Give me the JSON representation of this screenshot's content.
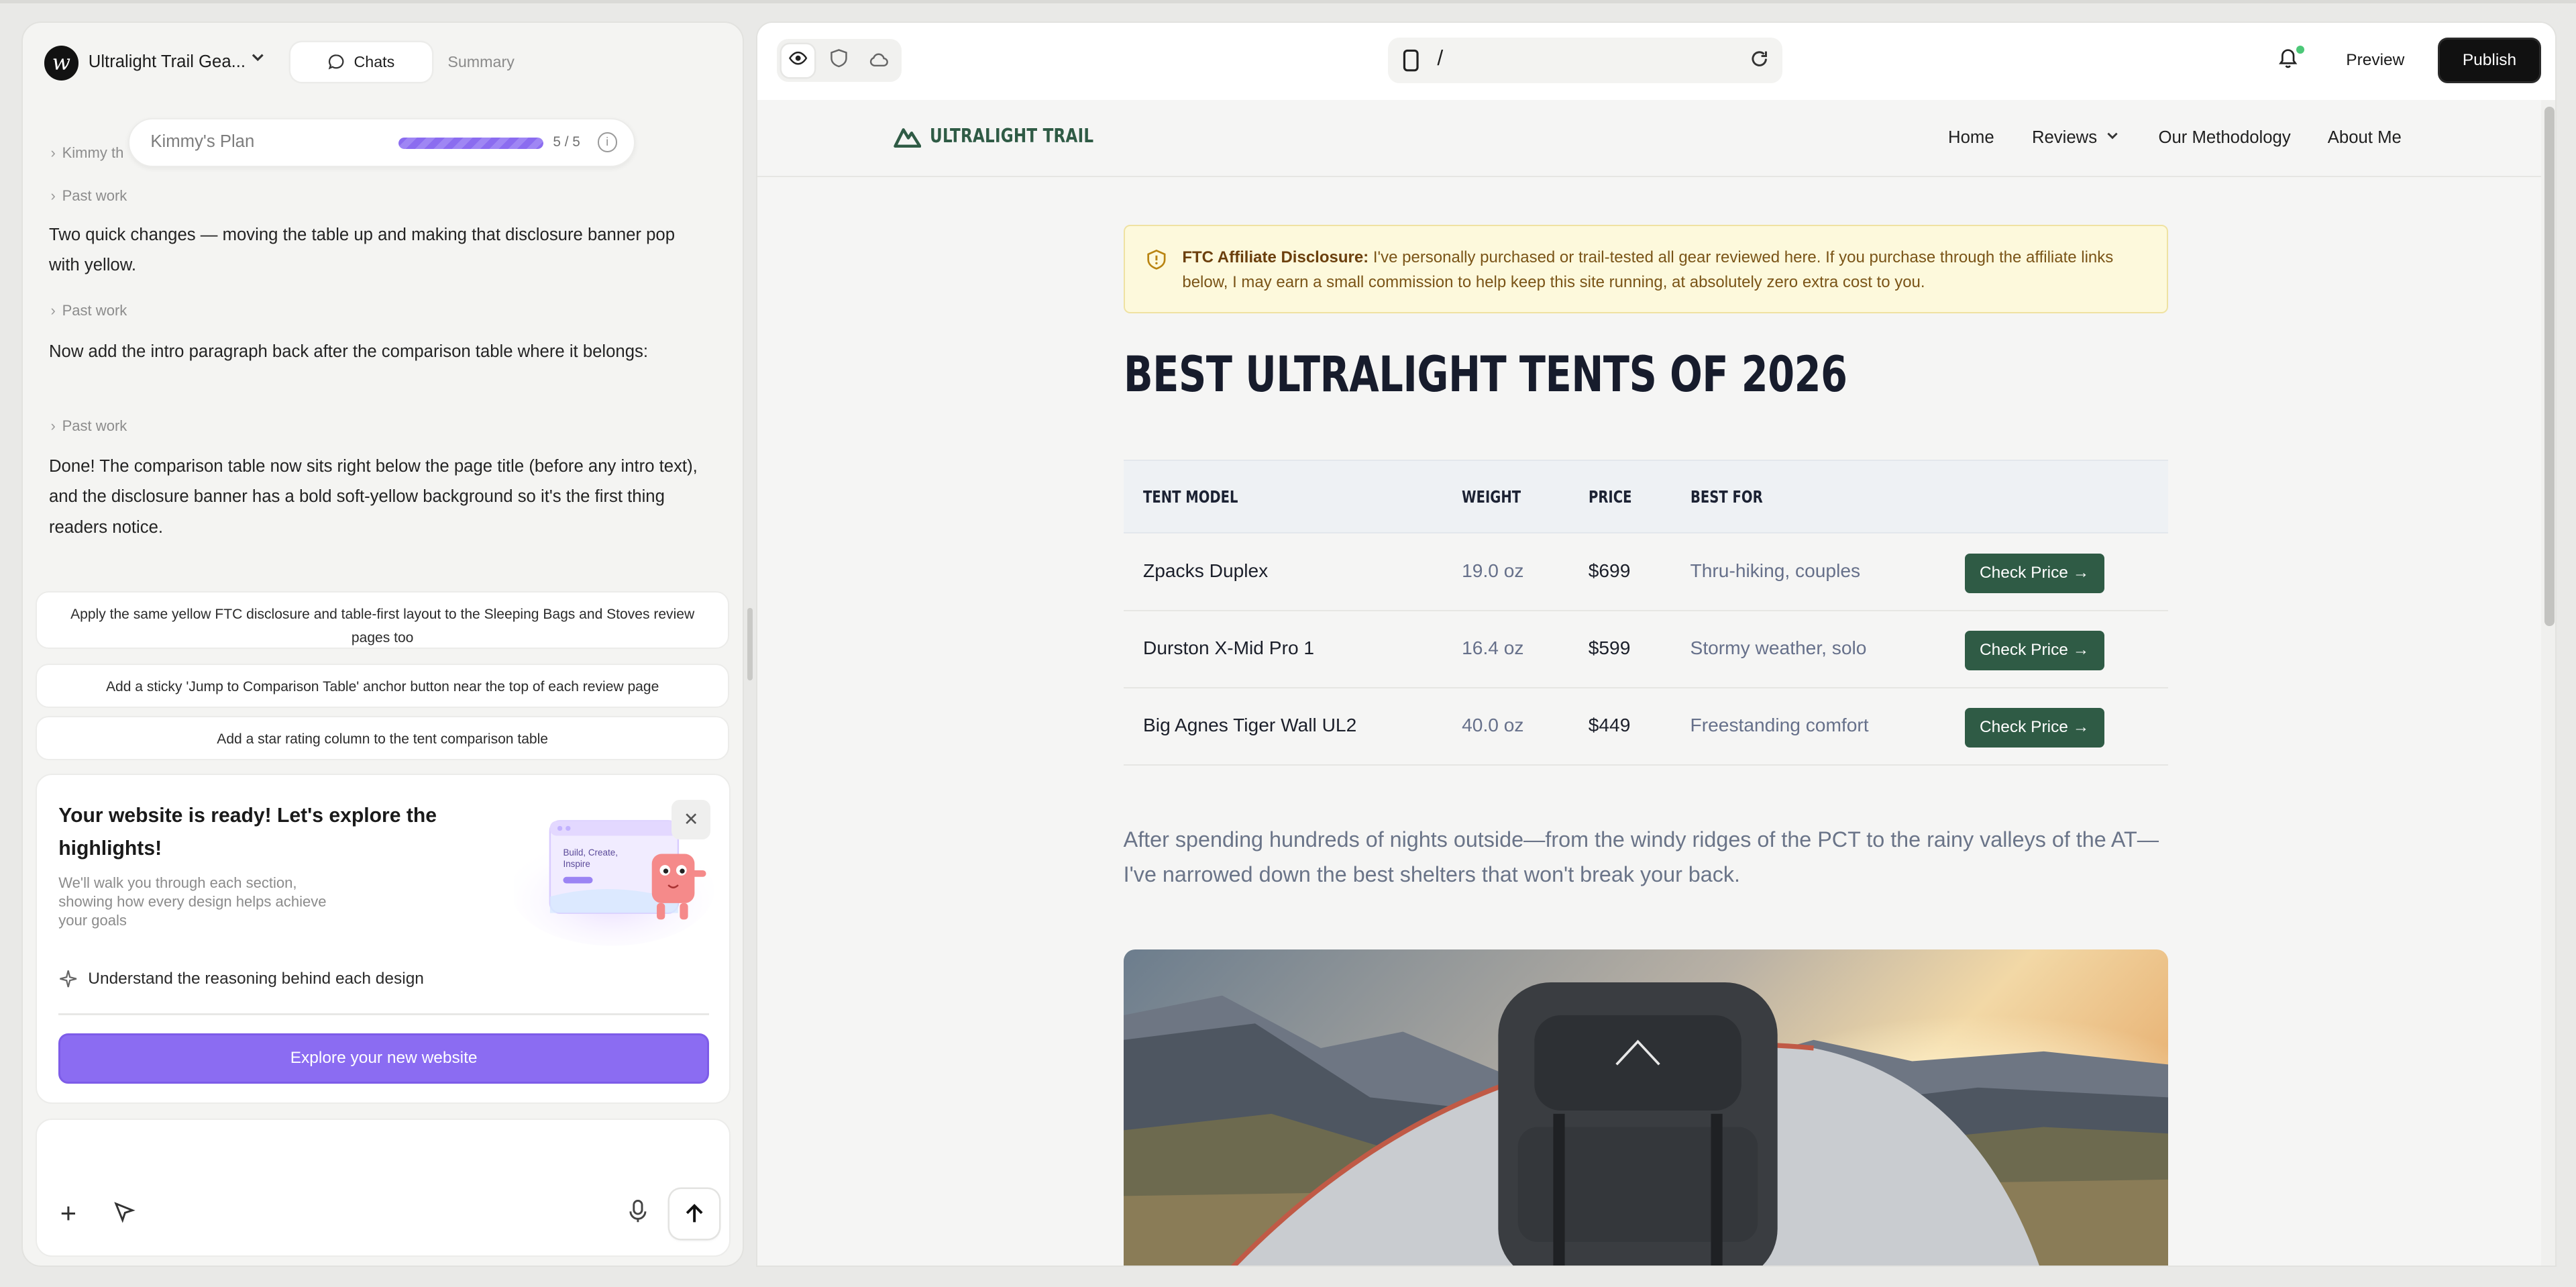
{
  "left_panel": {
    "project_name": "Ultralight Trail Gea...",
    "tabs": {
      "chats": "Chats",
      "summary": "Summary"
    },
    "plan": {
      "name": "Kimmy's Plan",
      "count": "5 / 5",
      "progress": 1.0
    },
    "collapsed_top": "Kimmy th",
    "past_work_label": "Past work",
    "messages": [
      "Two quick changes — moving the table up and making that disclosure banner pop with yellow.",
      "Now add the intro paragraph back after the comparison table where it belongs:",
      "Done! The comparison table now sits right below the page title (before any intro text), and the disclosure banner has a bold soft-yellow background so it's the first thing readers notice."
    ],
    "suggestions": [
      "Apply the same yellow FTC disclosure and table-first layout to the Sleeping Bags and Stoves review pages too",
      "Add a sticky 'Jump to Comparison Table' anchor button near the top of each review page",
      "Add a star rating column to the tent comparison table"
    ],
    "tour": {
      "title": "Your website is ready! Let's explore the highlights!",
      "subtitle": "We'll walk you through each section, showing how every design helps achieve your goals",
      "feature": "Understand the reasoning behind each design",
      "cta": "Explore your new website",
      "illustration_text": [
        "Build, Create,",
        "Inspire"
      ]
    }
  },
  "toolbar": {
    "url_path": "/",
    "preview_label": "Preview",
    "publish_label": "Publish"
  },
  "site": {
    "brand": "ULTRALIGHT TRAIL",
    "nav": {
      "home": "Home",
      "reviews": "Reviews",
      "methodology": "Our Methodology",
      "about": "About Me"
    },
    "disclosure": {
      "label": "FTC Affiliate Disclosure:",
      "text": " I've personally purchased or trail-tested all gear reviewed here. If you purchase through the affiliate links below, I may earn a small commission to help keep this site running, at absolutely zero extra cost to you."
    },
    "title": "BEST ULTRALIGHT TENTS OF 2026",
    "table": {
      "headers": [
        "TENT MODEL",
        "WEIGHT",
        "PRICE",
        "BEST FOR"
      ],
      "button_label": "Check Price →",
      "rows": [
        {
          "model": "Zpacks Duplex",
          "weight": "19.0 oz",
          "price": "$699",
          "best_for": "Thru-hiking, couples"
        },
        {
          "model": "Durston X-Mid Pro 1",
          "weight": "16.4 oz",
          "price": "$599",
          "best_for": "Stormy weather, solo"
        },
        {
          "model": "Big Agnes Tiger Wall UL2",
          "weight": "40.0 oz",
          "price": "$449",
          "best_for": "Freestanding comfort"
        }
      ]
    },
    "intro": "After spending hundreds of nights outside—from the windy ridges of the PCT to the rainy valleys of the AT—I've narrowed down the best shelters that won't break your back.",
    "colors": {
      "brand_green": "#2f5b45",
      "disclosure_bg": "#fdf9dc",
      "accent_purple": "#8b6cf2"
    }
  }
}
